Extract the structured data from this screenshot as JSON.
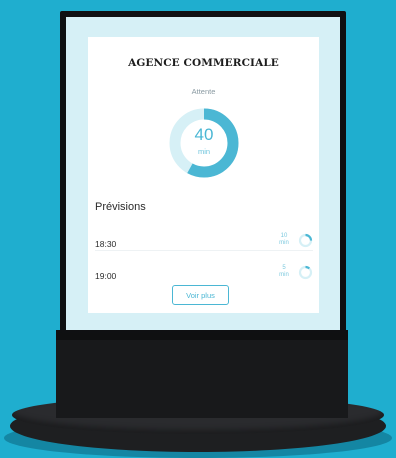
{
  "display": {
    "title": "AGENCE COMMERCIALE",
    "subtitle": "Attente",
    "wait": {
      "value": "40",
      "unit": "min",
      "progress": 0.58
    },
    "forecast_title": "Prévisions",
    "forecasts": [
      {
        "time": "18:30",
        "value": "10",
        "unit": "min",
        "progress": 0.25
      },
      {
        "time": "19:00",
        "value": "5",
        "unit": "min",
        "progress": 0.12
      }
    ],
    "more_button": "Voir plus"
  },
  "colors": {
    "background": "#1faecf",
    "accent": "#4bb7d4",
    "accent_light": "#d6f0f6"
  }
}
